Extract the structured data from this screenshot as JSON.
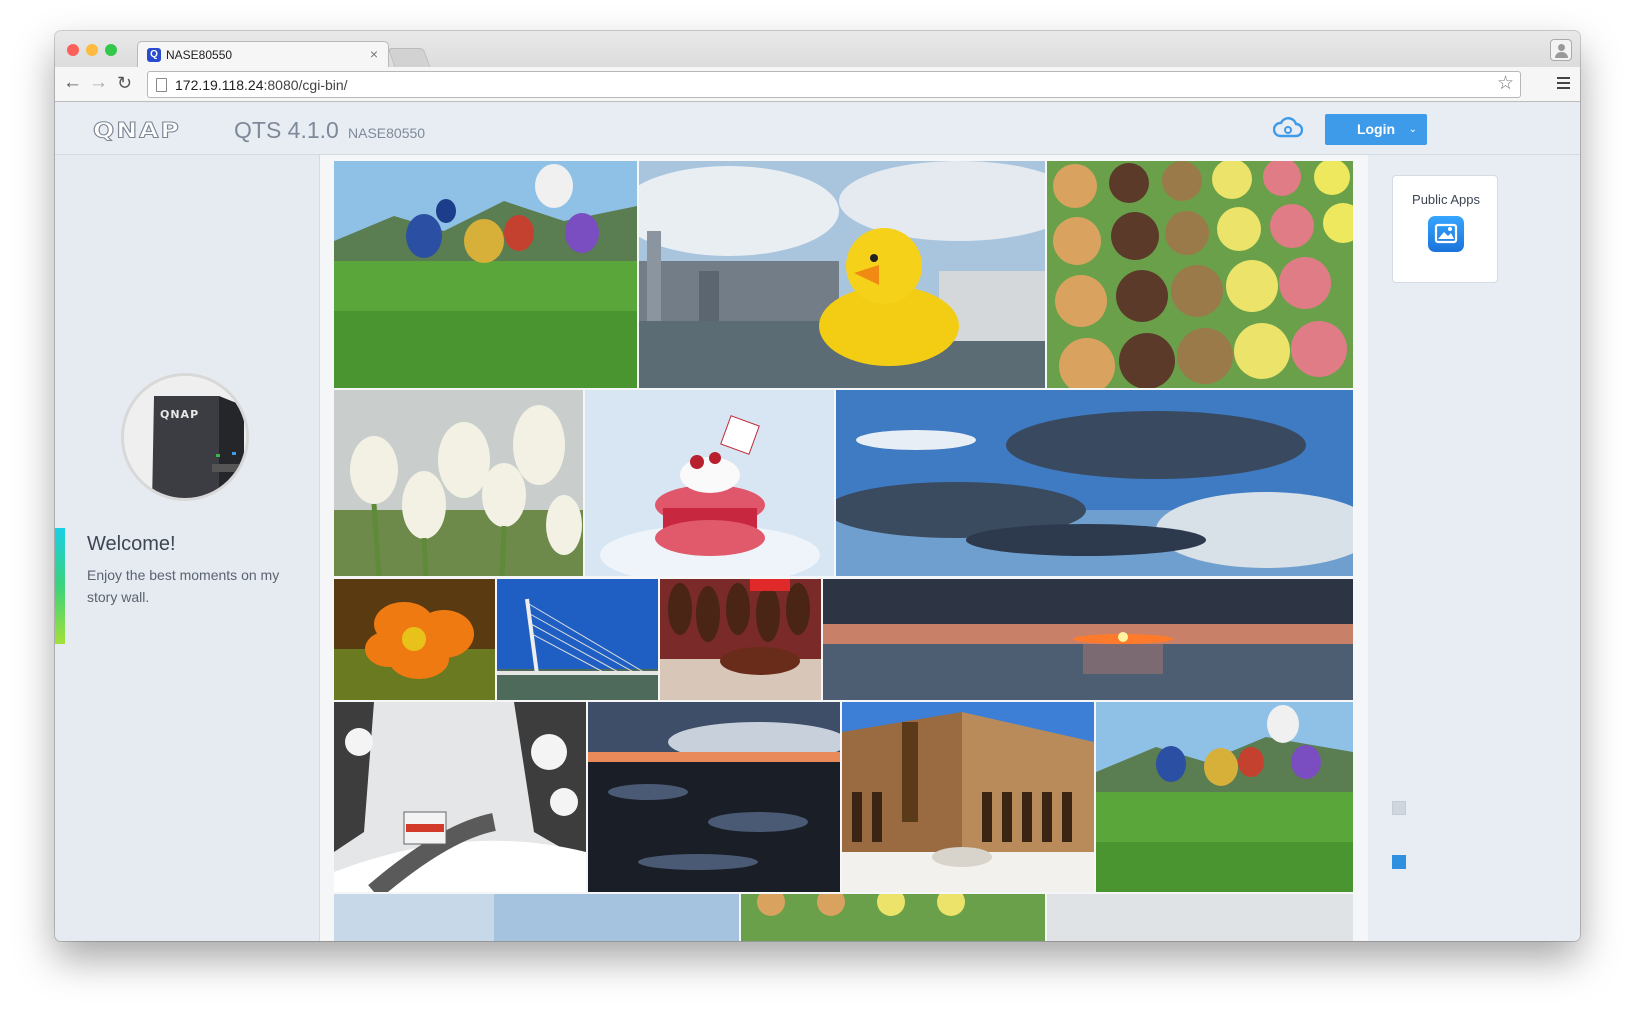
{
  "browser": {
    "tab_title": "NASE80550",
    "tab_favicon": "Q",
    "tab_close": "×",
    "url_host": "172.19.118.24",
    "url_rest": ":8080/cgi-bin/",
    "traffic_lights": [
      "#fc605b",
      "#fdbc40",
      "#34c84a"
    ]
  },
  "header": {
    "logo": "QNAP",
    "version": "QTS 4.1.0",
    "device_name": "NASE80550",
    "login_label": "Login",
    "login_chevron": "⌄",
    "accent_color": "#3d9be9"
  },
  "sidebar": {
    "device_logo": "QNAP",
    "welcome_title": "Welcome!",
    "welcome_text": "Enjoy the best moments on my story wall."
  },
  "right_panel": {
    "public_apps_label": "Public Apps",
    "app_icon": "photo-station-icon"
  },
  "photos": [
    {
      "name": "photo-hot-air-balloons"
    },
    {
      "name": "photo-rubber-duck-harbour"
    },
    {
      "name": "photo-macarons"
    },
    {
      "name": "photo-white-tulips"
    },
    {
      "name": "photo-raspberry-macaron-dessert"
    },
    {
      "name": "photo-cloudy-sky"
    },
    {
      "name": "photo-orange-poppy"
    },
    {
      "name": "photo-cable-bridge"
    },
    {
      "name": "photo-ham-market"
    },
    {
      "name": "photo-ocean-sunset"
    },
    {
      "name": "photo-snowy-road-bus"
    },
    {
      "name": "photo-rocky-shore-dusk"
    },
    {
      "name": "photo-alhambra-courtyard"
    },
    {
      "name": "photo-hot-air-balloons-2"
    }
  ]
}
